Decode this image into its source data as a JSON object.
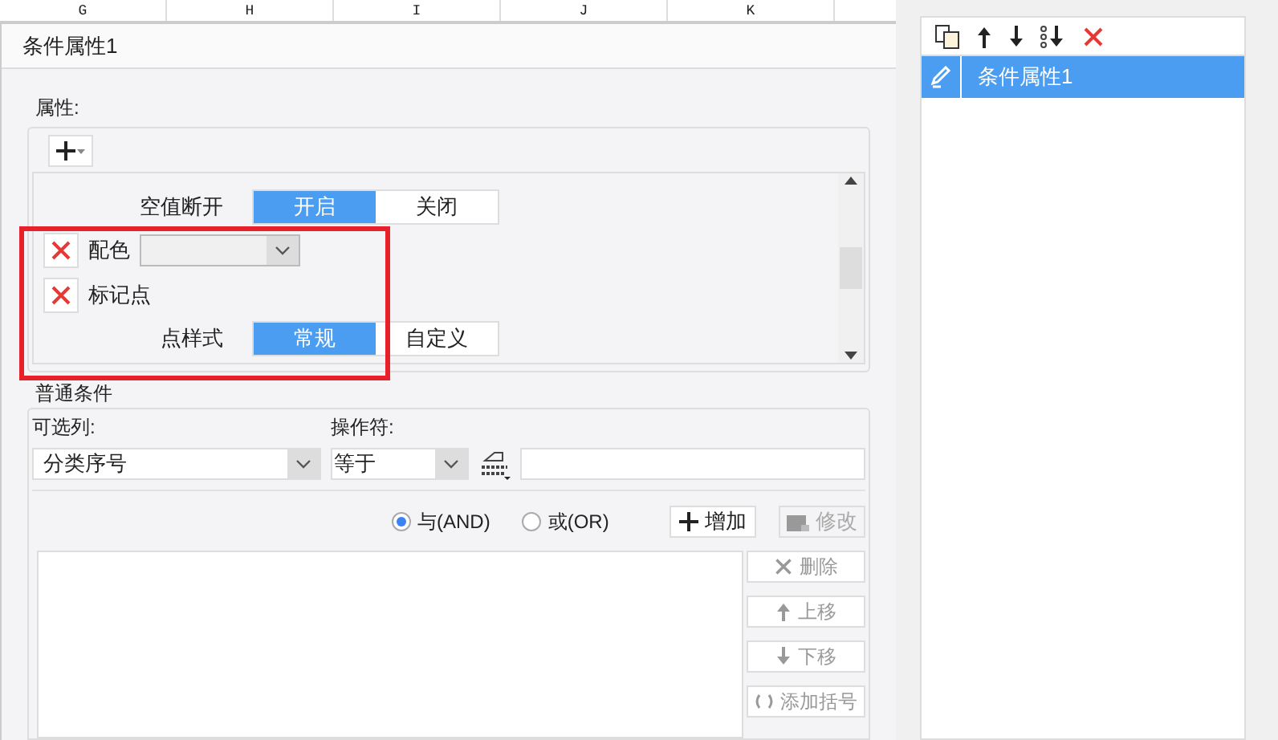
{
  "spreadsheet": {
    "columns": [
      "G",
      "H",
      "I",
      "J",
      "K"
    ]
  },
  "dialog": {
    "title": "条件属性1",
    "properties": {
      "legend": "属性:",
      "rows": [
        {
          "kind": "toggle",
          "label": "空值断开",
          "options": [
            {
              "label": "开启",
              "selected": true
            },
            {
              "label": "关闭",
              "selected": false
            }
          ]
        },
        {
          "kind": "color",
          "label": "配色"
        },
        {
          "kind": "item",
          "label": "标记点"
        },
        {
          "kind": "toggle",
          "label": "点样式",
          "options": [
            {
              "label": "常规",
              "selected": true
            },
            {
              "label": "自定义",
              "selected": false
            }
          ]
        }
      ]
    },
    "condition": {
      "legend": "普通条件",
      "column_label": "可选列:",
      "column_value": "分类序号",
      "operator_label": "操作符:",
      "operator_value": "等于",
      "logic": [
        {
          "label": "与(AND)",
          "selected": true
        },
        {
          "label": "或(OR)",
          "selected": false
        }
      ],
      "add": {
        "label": "增加",
        "disabled": false
      },
      "modify": {
        "label": "修改",
        "disabled": true
      },
      "side_buttons": [
        {
          "kind": "delete",
          "label": "删除",
          "disabled": true
        },
        {
          "kind": "up",
          "label": "上移",
          "disabled": true
        },
        {
          "kind": "down",
          "label": "下移",
          "disabled": true
        },
        {
          "kind": "bracket",
          "label": "添加括号",
          "disabled": true
        }
      ]
    }
  },
  "right_panel": {
    "items": [
      {
        "label": "条件属性1",
        "selected": true
      }
    ]
  }
}
